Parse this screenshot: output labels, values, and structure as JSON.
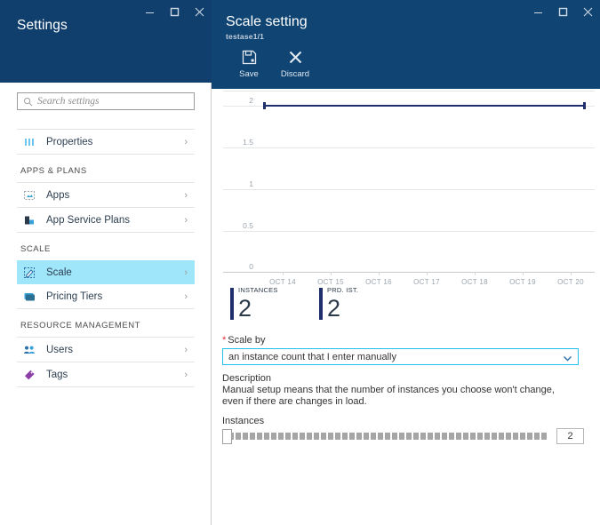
{
  "settings_window": {
    "title": "Settings",
    "window_controls": [
      {
        "name": "minimize",
        "glyph": "minimize-icon"
      },
      {
        "name": "maximize",
        "glyph": "maximize-icon"
      },
      {
        "name": "close",
        "glyph": "close-icon"
      }
    ],
    "search": {
      "placeholder": "Search settings",
      "value": "",
      "icon": "search-icon"
    },
    "nav": [
      {
        "type": "item",
        "label": "Properties",
        "icon": "properties-icon",
        "selected": false,
        "chevron": "›"
      },
      {
        "type": "group",
        "label": "APPS & PLANS"
      },
      {
        "type": "item",
        "label": "Apps",
        "icon": "apps-icon",
        "selected": false,
        "chevron": "›"
      },
      {
        "type": "item",
        "label": "App Service Plans",
        "icon": "app-service-plans-icon",
        "selected": false,
        "chevron": "›"
      },
      {
        "type": "group",
        "label": "SCALE"
      },
      {
        "type": "item",
        "label": "Scale",
        "icon": "scale-icon",
        "selected": true,
        "chevron": "›"
      },
      {
        "type": "item",
        "label": "Pricing Tiers",
        "icon": "pricing-tiers-icon",
        "selected": false,
        "chevron": "›"
      },
      {
        "type": "group",
        "label": "RESOURCE MANAGEMENT"
      },
      {
        "type": "item",
        "label": "Users",
        "icon": "users-icon",
        "selected": false,
        "chevron": "›"
      },
      {
        "type": "item",
        "label": "Tags",
        "icon": "tags-icon",
        "selected": false,
        "chevron": "›"
      }
    ]
  },
  "scale_window": {
    "title": "Scale setting",
    "subtitle": "testase1/1",
    "commands": [
      {
        "label": "Save",
        "icon": "save-icon"
      },
      {
        "label": "Discard",
        "icon": "discard-icon"
      }
    ],
    "tiles": [
      {
        "label": "INSTANCES",
        "value": "2"
      },
      {
        "label": "PRD. IST.",
        "value": "2"
      }
    ],
    "form": {
      "scale_by_label": "Scale by",
      "required_marker": "*",
      "scale_by_value": "an instance count that I enter manually",
      "description_label": "Description",
      "description_text": "Manual setup means that the number of instances you choose won't change, even if there are changes in load.",
      "instances_label": "Instances",
      "instances_value": "2",
      "slider": {
        "min": 1,
        "max": 20,
        "value": 2
      }
    }
  },
  "chart_data": {
    "type": "line",
    "title": "",
    "xlabel": "",
    "ylabel": "",
    "x": [
      "OCT 14",
      "OCT 15",
      "OCT 16",
      "OCT 17",
      "OCT 18",
      "OCT 19",
      "OCT 20"
    ],
    "y_ticks": [
      "2",
      "1.5",
      "1",
      "0.5",
      "0"
    ],
    "ylim": [
      0,
      2
    ],
    "grid": true,
    "legend": "none",
    "series": [
      {
        "name": "Instances",
        "color": "#1f2f6e",
        "values": [
          2,
          2,
          2,
          2,
          2,
          2,
          2
        ]
      }
    ]
  },
  "colors": {
    "title_bar": "#0f4473",
    "accent_selected": "#a0e6fb",
    "series": "#1f2f6e",
    "required": "#e12b3b",
    "focus_border": "#27c0ed"
  }
}
